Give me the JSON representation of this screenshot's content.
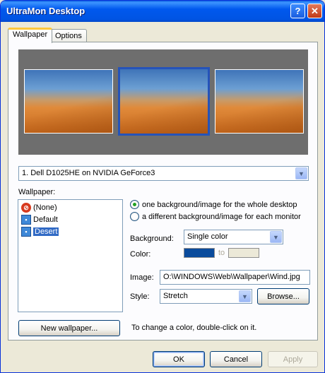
{
  "window": {
    "title": "UltraMon Desktop",
    "help_label": "?",
    "close_label": "✕"
  },
  "tabs": [
    {
      "label": "Wallpaper",
      "active": true
    },
    {
      "label": "Options",
      "active": false
    }
  ],
  "preview": {
    "monitors": [
      "Desert",
      "Desert",
      "Desert"
    ],
    "selected_monitor": 2
  },
  "monitor_select": {
    "value": "1. Dell D1025HE on NVIDIA GeForce3",
    "arrow": "▼"
  },
  "wallpaper_list": {
    "label": "Wallpaper:",
    "items": [
      {
        "label": "(None)",
        "icon": "none-icon"
      },
      {
        "label": "Default",
        "icon": "image-file-icon"
      },
      {
        "label": "Desert",
        "icon": "image-file-icon",
        "selected": true
      }
    ]
  },
  "mode": {
    "option_single": "one background/image for the whole desktop",
    "option_each": "a different background/image for each monitor",
    "selected": "single"
  },
  "background": {
    "label": "Background:",
    "value": "Single color",
    "arrow": "▼"
  },
  "color": {
    "label": "Color:",
    "to_label": "to",
    "color1": "#0a4b9c",
    "color2": "#ece9d8"
  },
  "image": {
    "label": "Image:",
    "value": "O:\\WINDOWS\\Web\\Wallpaper\\Wind.jpg"
  },
  "style": {
    "label": "Style:",
    "value": "Stretch",
    "arrow": "▼",
    "browse_label": "Browse..."
  },
  "new_wallpaper_label": "New wallpaper...",
  "hint": "To change a color, double-click on it.",
  "footer": {
    "ok_label": "OK",
    "cancel_label": "Cancel",
    "apply_label": "Apply"
  },
  "colors": {
    "titlebar": "#0054e3",
    "tab_highlight": "#ffc83c",
    "selection": "#316ac5"
  }
}
